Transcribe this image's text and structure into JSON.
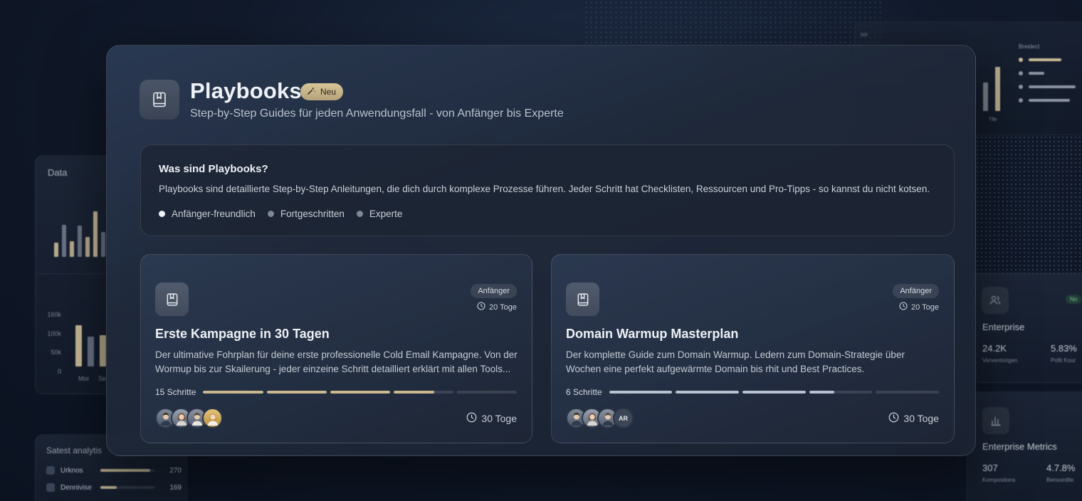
{
  "background": {
    "left_panel": {
      "title": "Data",
      "ticks": [
        "160k",
        "100k",
        "50k",
        "0"
      ],
      "axis_labels": [
        "Mor",
        "Se"
      ]
    },
    "left_bottom": {
      "title": "Satest analytis",
      "rows": [
        {
          "name": "Urknos",
          "value": "270",
          "progress": 0.92
        },
        {
          "name": "Dennivise",
          "value": "169",
          "progress": 0.3
        }
      ]
    },
    "right_top": {
      "title": "Breidect",
      "label_top": "500",
      "label_bottom": "Tfle"
    },
    "right_mid": {
      "title": "Enterprise",
      "tag": "No",
      "stat1": "24.2K",
      "stat1_sub": "Verventorigen",
      "stat2": "5.83%",
      "stat2_sub": "Pofit Kour"
    },
    "right_bot": {
      "title": "Enterprise Metrics",
      "stat1": "307",
      "stat1_sub": "Kompostions",
      "stat2": "4.7.8%",
      "stat2_sub": "Bensordtle"
    }
  },
  "header": {
    "title": "Playbooks",
    "badge": "Neu",
    "subtitle": "Step-by-Step Guides für jeden Anwendungsfall - von Anfänger bis Experte"
  },
  "info": {
    "title": "Was sind Playbooks?",
    "text": "Playbooks sind detaillierte Step-by-Step Anleitungen, die dich durch komplexe Prozesse führen.  Jeder Schritt hat Checklisten, Ressourcen und Pro-Tipps - so kannst du nicht kotsen.",
    "levels": [
      "Anfänger-freundlich",
      "Fortgeschritten",
      "Experte"
    ]
  },
  "cards": [
    {
      "level": "Anfänger",
      "duration_top": "20 Toge",
      "title": "Erste Kampagne in 30 Tagen",
      "description": "Der ultimative Fohrplan für deine erste professionelle Cold Email Kampagne. Von der Wormup bis zur Skailerung - jeder einzeine Schritt detailliert erklärt mit allen Tools...",
      "steps_label": "15 Schritte",
      "segments": [
        1,
        1,
        1,
        0.68,
        0
      ],
      "duration_bottom": "30 Toge"
    },
    {
      "level": "Anfänger",
      "duration_top": "20 Toge",
      "title": "Domain Warmup Masterplan",
      "description": "Der komplette Guide zum Domain Warmup. Ledern zum Domain-Strategie über Wochen eine perfekt aufgewärmte Domain bis rhit und Best Practices.",
      "steps_label": "6 Schritte",
      "segments": [
        1,
        1,
        1,
        0.4,
        0
      ],
      "avatar_initials": "AR",
      "duration_bottom": "30 Toge"
    }
  ],
  "colors": {
    "accent_gold": "#c9b88f",
    "badge_gold": "#d8c698",
    "progress_silver": "#b8c1cf"
  }
}
